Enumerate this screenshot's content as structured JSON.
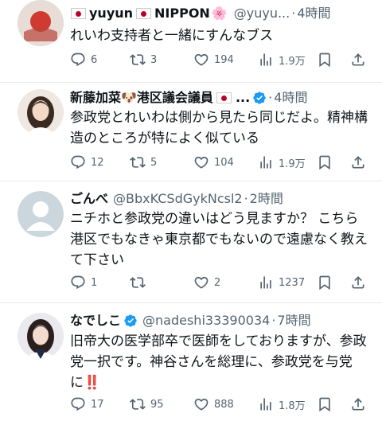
{
  "tweets": [
    {
      "name": "yuyun",
      "name2": "NIPPON",
      "emoji": "🌸",
      "handle": "@yuyu...",
      "time": "4時間",
      "text": "れいわ支持者と一緒にすんなブス",
      "stats": {
        "reply": "6",
        "retweet": "3",
        "like": "194",
        "views": "1.9万"
      }
    },
    {
      "name": "新藤加菜🐶港区議会議員",
      "handle": "...",
      "time": "4時間",
      "text": "参政党とれいわは側から見たら同じだよ。精神構造のところが特によく似ている",
      "stats": {
        "reply": "12",
        "retweet": "5",
        "like": "104",
        "views": "1.9万"
      }
    },
    {
      "name": "ごんべ",
      "handle": "@BbxKCSdGykNcsl2",
      "time": "2時間",
      "text": "ニチホと参政党の違いはどう見ますか？ こちら港区でもなきゃ東京都でもないので遠慮なく教えて下さい",
      "stats": {
        "reply": "1",
        "retweet": "",
        "like": "2",
        "views": "1237"
      }
    },
    {
      "name": "なでしこ",
      "handle": "@nadeshi33390034",
      "time": "7時間",
      "text": "旧帝大の医学部卒で医師をしておりますが、参政党一択です。神谷さんを総理に、参政党を与党に‼️",
      "stats": {
        "reply": "17",
        "retweet": "95",
        "like": "888",
        "views": "1.8万"
      }
    }
  ],
  "icons": [
    "reply-icon",
    "retweet-icon",
    "like-icon",
    "views-icon",
    "bookmark-icon",
    "share-icon",
    "verified-badge-icon",
    "japan-flag-icon"
  ],
  "colors": {
    "text": "#0f1419",
    "secondary": "#536471",
    "verified": "#1d9bf0",
    "flag_red": "#bc002d",
    "divider": "#e6e8eb"
  }
}
